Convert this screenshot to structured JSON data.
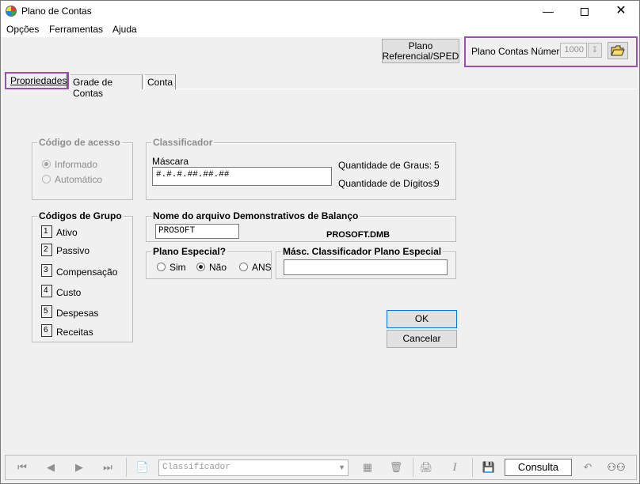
{
  "window": {
    "title": "Plano de Contas"
  },
  "menu": [
    {
      "label": "Opções"
    },
    {
      "label": "Ferramentas"
    },
    {
      "label": "Ajuda"
    }
  ],
  "toolbar": {
    "plano_referencial_line1": "Plano",
    "plano_referencial_line2": "Referencial/SPED",
    "plano_contas_numero_label": "Plano Contas Número",
    "plano_contas_numero_value": "1000"
  },
  "tabs": [
    {
      "label": "Propriedades"
    },
    {
      "label": "Grade de Contas"
    },
    {
      "label": "Conta"
    }
  ],
  "codigo_acesso": {
    "title": "Código de acesso",
    "informado": "Informado",
    "automatico": "Automático"
  },
  "classificador": {
    "title": "Classificador",
    "mascara_label": "Máscara",
    "mascara_value": "#.#.#.##.##.##",
    "graus_label": "Quantidade de Graus:",
    "graus_value": "5",
    "digitos_label": "Quantidade de Dígitos:",
    "digitos_value": "9"
  },
  "codigos_grupo": {
    "title": "Códigos de Grupo",
    "items": [
      {
        "num": "1",
        "label": "Ativo"
      },
      {
        "num": "2",
        "label": "Passivo"
      },
      {
        "num": "3",
        "label": "Compensação"
      },
      {
        "num": "4",
        "label": "Custo"
      },
      {
        "num": "5",
        "label": "Despesas"
      },
      {
        "num": "6",
        "label": "Receitas"
      }
    ]
  },
  "demonstrativos": {
    "title": "Nome do arquivo Demonstrativos de Balanço",
    "value": "PROSOFT",
    "filename": "PROSOFT.DMB"
  },
  "plano_especial": {
    "title": "Plano Especial?",
    "sim": "Sim",
    "nao": "Não",
    "ans": "ANS"
  },
  "masc_especial": {
    "title": "Másc. Classificador Plano Especial",
    "value": ""
  },
  "buttons": {
    "ok": "OK",
    "cancelar": "Cancelar"
  },
  "bottom": {
    "classificador_placeholder": "Classificador",
    "consulta": "Consulta"
  }
}
